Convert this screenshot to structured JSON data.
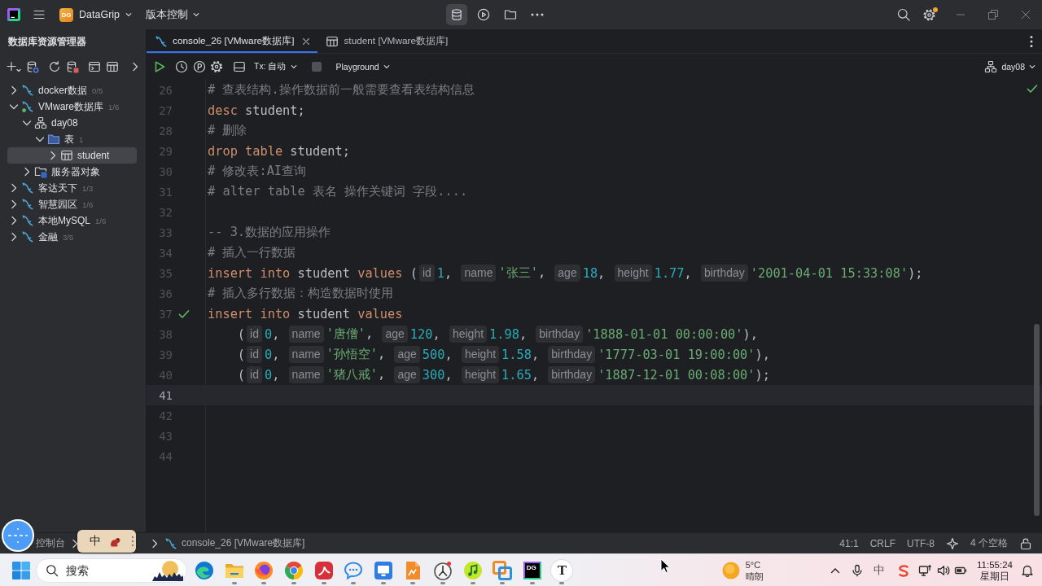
{
  "title_bar": {
    "project_badge": "DG",
    "project": "DataGrip",
    "vcs": "版本控制",
    "tools": [
      {
        "kind": "database",
        "selected": true
      },
      {
        "kind": "run",
        "selected": false
      },
      {
        "kind": "folder",
        "selected": false
      },
      {
        "kind": "more",
        "selected": false
      }
    ],
    "settings_has_update": true
  },
  "database_explorer": {
    "title": "数据库资源管理器",
    "tree": [
      {
        "kind": "datasource",
        "label": "docker数据",
        "badge": "0/5",
        "expanded": false,
        "selected": false,
        "connected": false
      },
      {
        "kind": "datasource",
        "label": "VMware数据库",
        "badge": "1/6",
        "expanded": true,
        "selected": false,
        "connected": true,
        "children": [
          {
            "kind": "schema",
            "label": "day08",
            "expanded": true,
            "selected": false,
            "children": [
              {
                "kind": "folder",
                "label": "表",
                "badge": "1",
                "expanded": true,
                "selected": false,
                "children": [
                  {
                    "kind": "table",
                    "label": "student",
                    "expanded": false,
                    "selected": true
                  }
                ]
              }
            ]
          },
          {
            "kind": "server_objects",
            "label": "服务器对象",
            "expanded": false,
            "selected": false
          }
        ]
      },
      {
        "kind": "datasource",
        "label": "客达天下",
        "badge": "1/3",
        "expanded": false,
        "selected": false,
        "connected": false
      },
      {
        "kind": "datasource",
        "label": "智慧园区",
        "badge": "1/6",
        "expanded": false,
        "selected": false,
        "connected": false
      },
      {
        "kind": "datasource",
        "label": "本地MySQL",
        "badge": "1/6",
        "expanded": false,
        "selected": false,
        "connected": false
      },
      {
        "kind": "datasource",
        "label": "金融",
        "badge": "3/5",
        "expanded": false,
        "selected": false,
        "connected": false
      }
    ]
  },
  "editor": {
    "tabs": [
      {
        "kind": "console",
        "label": "console_26 [VMware数据库]",
        "selected": true
      },
      {
        "kind": "table",
        "label": "student [VMware数据库]",
        "selected": false
      }
    ],
    "toolbar": {
      "transaction": "Tx: 自动",
      "mode": "Playground",
      "schema": "day08"
    },
    "lines": [
      {
        "number": "26",
        "executed": false,
        "current": false,
        "tokens": [
          {
            "kind": "comment",
            "text": "# 查表结构.操作数据前一般需要查看表结构信息"
          }
        ]
      },
      {
        "number": "27",
        "executed": false,
        "current": false,
        "tokens": [
          {
            "kind": "keyword",
            "text": "desc"
          },
          {
            "kind": "plain",
            "text": " student;"
          }
        ]
      },
      {
        "number": "28",
        "executed": false,
        "current": false,
        "tokens": [
          {
            "kind": "comment",
            "text": "# 删除"
          }
        ]
      },
      {
        "number": "29",
        "executed": false,
        "current": false,
        "tokens": [
          {
            "kind": "keyword",
            "text": "drop table"
          },
          {
            "kind": "plain",
            "text": " student;"
          }
        ]
      },
      {
        "number": "30",
        "executed": false,
        "current": false,
        "tokens": [
          {
            "kind": "comment",
            "text": "# 修改表:AI查询"
          }
        ]
      },
      {
        "number": "31",
        "executed": false,
        "current": false,
        "tokens": [
          {
            "kind": "comment",
            "text": "# alter table 表名 操作关键词 字段...."
          }
        ]
      },
      {
        "number": "32",
        "executed": false,
        "current": false
      },
      {
        "number": "33",
        "executed": false,
        "current": false,
        "tokens": [
          {
            "kind": "comment",
            "text": "-- 3.数据的应用操作"
          }
        ]
      },
      {
        "number": "34",
        "executed": false,
        "current": false,
        "tokens": [
          {
            "kind": "comment",
            "text": "# 插入一行数据"
          }
        ]
      },
      {
        "number": "35",
        "executed": false,
        "current": false,
        "tokens": [
          {
            "kind": "keyword",
            "text": "insert into"
          },
          {
            "kind": "plain",
            "text": " student "
          },
          {
            "kind": "keyword",
            "text": "values"
          },
          {
            "kind": "plain",
            "text": " ("
          },
          {
            "kind": "hint",
            "text": "id"
          },
          {
            "kind": "number",
            "text": "1"
          },
          {
            "kind": "plain",
            "text": ", "
          },
          {
            "kind": "hint",
            "text": "name"
          },
          {
            "kind": "string",
            "text": "'张三'"
          },
          {
            "kind": "plain",
            "text": ", "
          },
          {
            "kind": "hint",
            "text": "age"
          },
          {
            "kind": "number",
            "text": "18"
          },
          {
            "kind": "plain",
            "text": ", "
          },
          {
            "kind": "hint",
            "text": "height"
          },
          {
            "kind": "number",
            "text": "1.77"
          },
          {
            "kind": "plain",
            "text": ", "
          },
          {
            "kind": "hint",
            "text": "birthday"
          },
          {
            "kind": "string",
            "text": "'2001-04-01 15:33:08'"
          },
          {
            "kind": "plain",
            "text": ");"
          }
        ]
      },
      {
        "number": "36",
        "executed": false,
        "current": false,
        "tokens": [
          {
            "kind": "comment",
            "text": "# 插入多行数据：构造数据时使用"
          }
        ]
      },
      {
        "number": "37",
        "executed": true,
        "current": false,
        "tokens": [
          {
            "kind": "keyword",
            "text": "insert into"
          },
          {
            "kind": "plain",
            "text": " student "
          },
          {
            "kind": "keyword",
            "text": "values"
          }
        ]
      },
      {
        "number": "38",
        "executed": false,
        "current": false,
        "tokens": [
          {
            "kind": "plain",
            "text": "    ("
          },
          {
            "kind": "hint",
            "text": "id"
          },
          {
            "kind": "number",
            "text": "0"
          },
          {
            "kind": "plain",
            "text": ", "
          },
          {
            "kind": "hint",
            "text": "name"
          },
          {
            "kind": "string",
            "text": "'唐僧'"
          },
          {
            "kind": "plain",
            "text": ", "
          },
          {
            "kind": "hint",
            "text": "age"
          },
          {
            "kind": "number",
            "text": "120"
          },
          {
            "kind": "plain",
            "text": ", "
          },
          {
            "kind": "hint",
            "text": "height"
          },
          {
            "kind": "number",
            "text": "1.98"
          },
          {
            "kind": "plain",
            "text": ", "
          },
          {
            "kind": "hint",
            "text": "birthday"
          },
          {
            "kind": "string",
            "text": "'1888-01-01 00:00:00'"
          },
          {
            "kind": "plain",
            "text": "),"
          }
        ]
      },
      {
        "number": "39",
        "executed": false,
        "current": false,
        "tokens": [
          {
            "kind": "plain",
            "text": "    ("
          },
          {
            "kind": "hint",
            "text": "id"
          },
          {
            "kind": "number",
            "text": "0"
          },
          {
            "kind": "plain",
            "text": ", "
          },
          {
            "kind": "hint",
            "text": "name"
          },
          {
            "kind": "string",
            "text": "'孙悟空'"
          },
          {
            "kind": "plain",
            "text": ", "
          },
          {
            "kind": "hint",
            "text": "age"
          },
          {
            "kind": "number",
            "text": "500"
          },
          {
            "kind": "plain",
            "text": ", "
          },
          {
            "kind": "hint",
            "text": "height"
          },
          {
            "kind": "number",
            "text": "1.58"
          },
          {
            "kind": "plain",
            "text": ", "
          },
          {
            "kind": "hint",
            "text": "birthday"
          },
          {
            "kind": "string",
            "text": "'1777-03-01 19:00:00'"
          },
          {
            "kind": "plain",
            "text": "),"
          }
        ]
      },
      {
        "number": "40",
        "executed": false,
        "current": false,
        "tokens": [
          {
            "kind": "plain",
            "text": "    ("
          },
          {
            "kind": "hint",
            "text": "id"
          },
          {
            "kind": "number",
            "text": "0"
          },
          {
            "kind": "plain",
            "text": ", "
          },
          {
            "kind": "hint",
            "text": "name"
          },
          {
            "kind": "string",
            "text": "'猪八戒'"
          },
          {
            "kind": "plain",
            "text": ", "
          },
          {
            "kind": "hint",
            "text": "age"
          },
          {
            "kind": "number",
            "text": "300"
          },
          {
            "kind": "plain",
            "text": ", "
          },
          {
            "kind": "hint",
            "text": "height"
          },
          {
            "kind": "number",
            "text": "1.65"
          },
          {
            "kind": "plain",
            "text": ", "
          },
          {
            "kind": "hint",
            "text": "birthday"
          },
          {
            "kind": "string",
            "text": "'1887-12-01 00:08:00'"
          },
          {
            "kind": "plain",
            "text": ");"
          }
        ]
      },
      {
        "number": "41",
        "executed": false,
        "current": true
      },
      {
        "number": "42",
        "executed": false,
        "current": false
      },
      {
        "number": "43",
        "executed": false,
        "current": false
      },
      {
        "number": "44",
        "executed": false,
        "current": false
      }
    ]
  },
  "status_bar": {
    "breadcrumbs": [
      {
        "kind": "label",
        "label": "控制台"
      },
      {
        "kind": "console",
        "label": "console_26 [VMware数据库]"
      }
    ],
    "position": "41:1",
    "line_separator": "CRLF",
    "encoding": "UTF-8",
    "indent": "4 个空格"
  },
  "ime_bar": {
    "mode": "中"
  },
  "taskbar": {
    "search": {
      "placeholder": "搜索"
    },
    "apps": [
      {
        "kind": "edge",
        "running": false
      },
      {
        "kind": "explorer",
        "running": true
      },
      {
        "kind": "firefox",
        "running": true
      },
      {
        "kind": "chrome",
        "running": true
      },
      {
        "kind": "pdf",
        "running": true
      },
      {
        "kind": "chat",
        "running": true
      },
      {
        "kind": "remote",
        "running": true
      },
      {
        "kind": "document",
        "running": true
      },
      {
        "kind": "clock",
        "running": true
      },
      {
        "kind": "music",
        "running": true
      },
      {
        "kind": "windows",
        "running": true
      },
      {
        "kind": "datagrip",
        "glyph": "DG",
        "running": true
      },
      {
        "kind": "typora",
        "glyph": "T",
        "running": true
      }
    ],
    "weather": {
      "temperature": "5°C",
      "condition": "晴朗"
    },
    "tray": {
      "input_method": "中"
    },
    "clock": {
      "time": "11:55:24",
      "day": "星期日"
    }
  }
}
